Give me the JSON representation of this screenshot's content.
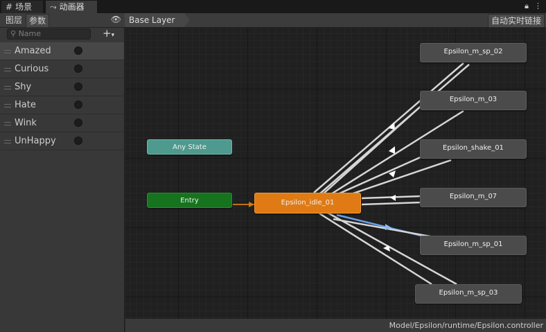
{
  "tabs": [
    {
      "icon": "grid-icon",
      "label": "场景"
    },
    {
      "icon": "animator-icon",
      "label": "动画器"
    }
  ],
  "left_panel": {
    "tabs": [
      "图层",
      "参数"
    ],
    "search_placeholder": "Name",
    "parameters": [
      {
        "name": "Amazed"
      },
      {
        "name": "Curious"
      },
      {
        "name": "Shy"
      },
      {
        "name": "Hate"
      },
      {
        "name": "Wink"
      },
      {
        "name": "UnHappy"
      }
    ]
  },
  "toolbar": {
    "breadcrumb": "Base Layer",
    "auto_live_link": "自动实时链接"
  },
  "graph": {
    "any_state": "Any State",
    "entry": "Entry",
    "default_state": "Epsilon_idle_01",
    "states": [
      "Epsilon_m_sp_02",
      "Epsilon_m_03",
      "Epsilon_shake_01",
      "Epsilon_m_07",
      "Epsilon_m_sp_01",
      "Epsilon_m_sp_03"
    ]
  },
  "status_bar": {
    "path": "Model/Epsilon/runtime/Epsilon.controller"
  },
  "colors": {
    "default_state": "#e07a14",
    "entry": "#16731e",
    "any_state": "#4f9a8e",
    "state": "#4b4b4b",
    "active_transition": "#6aa0e6",
    "transition": "#d6d6d6"
  }
}
